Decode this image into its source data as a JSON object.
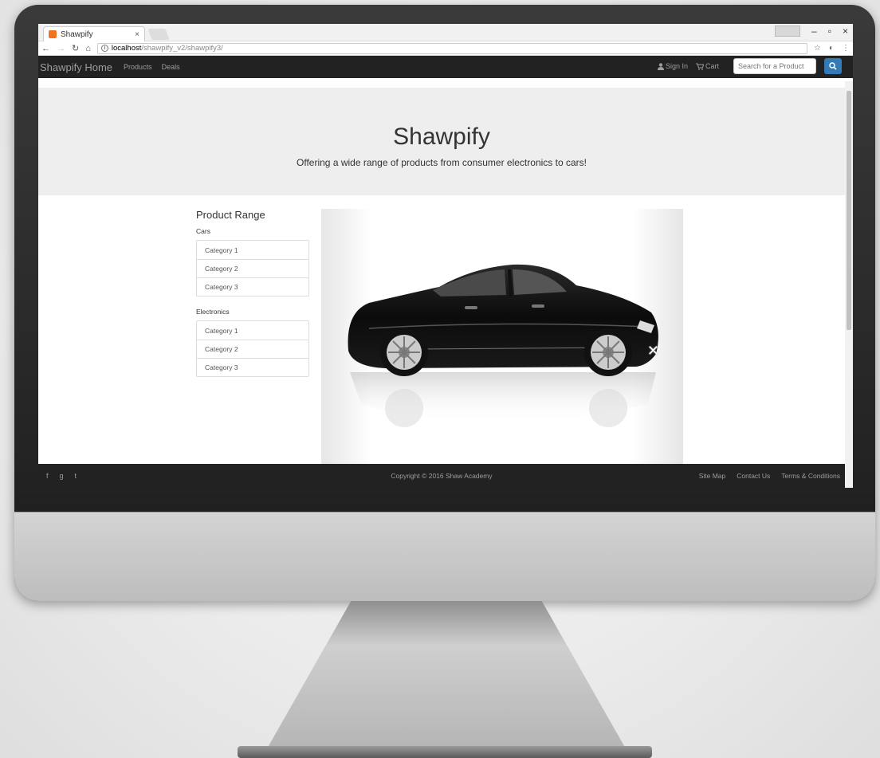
{
  "browser": {
    "tab_title": "Shawpify",
    "tab_close": "×",
    "url_host": "localhost",
    "url_path": "/shawpify_v2/shawpify3/",
    "win_minimize": "–",
    "win_restore": "▫",
    "win_close": "×"
  },
  "navbar": {
    "brand": "Shawpify Home",
    "links": [
      "Products",
      "Deals"
    ],
    "sign_in": "Sign In",
    "cart": "Cart",
    "search_placeholder": "Search for a Product"
  },
  "jumbotron": {
    "title": "Shawpify",
    "subtitle": "Offering a wide range of products from consumer electronics to cars!"
  },
  "sidebar": {
    "heading": "Product Range",
    "groups": [
      {
        "name": "Cars",
        "items": [
          "Category 1",
          "Category 2",
          "Category 3"
        ]
      },
      {
        "name": "Electronics",
        "items": [
          "Category 1",
          "Category 2",
          "Category 3"
        ]
      }
    ]
  },
  "carousel": {
    "close_glyph": "✕"
  },
  "footer": {
    "social": [
      "f",
      "g",
      "t"
    ],
    "copyright": "Copyright © 2016 Shaw Academy",
    "links": [
      "Site Map",
      "Contact Us",
      "Terms & Conditions"
    ]
  },
  "colors": {
    "navbar_bg": "#222222",
    "jumbotron_bg": "#eeeeee",
    "search_button": "#337ab7",
    "favicon": "#f0741f"
  }
}
